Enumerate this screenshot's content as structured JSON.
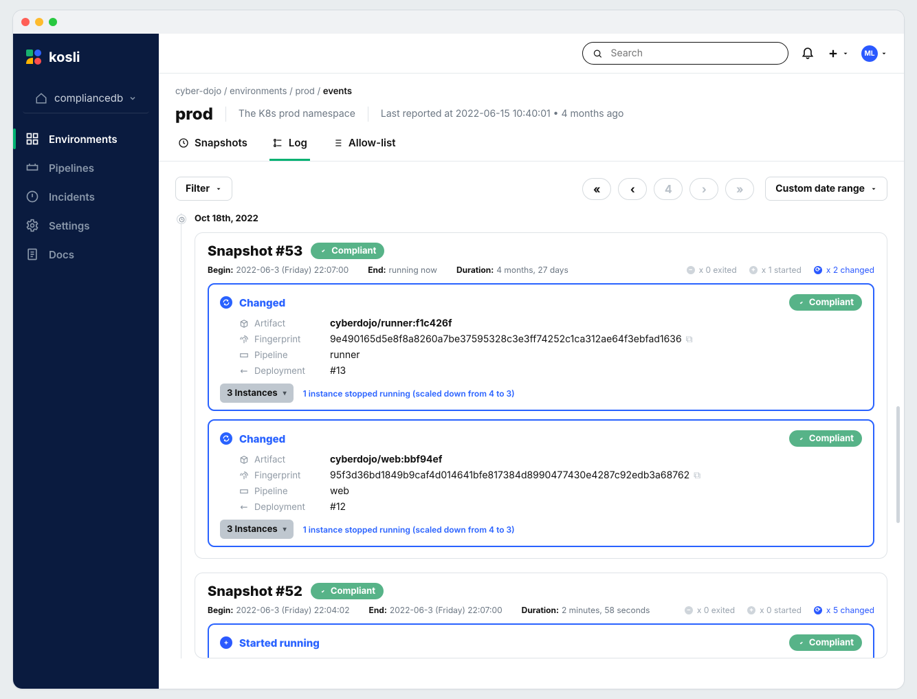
{
  "brand": {
    "name": "kosli"
  },
  "org": {
    "name": "compliancedb"
  },
  "sidebar": {
    "items": [
      {
        "label": "Environments",
        "active": true
      },
      {
        "label": "Pipelines"
      },
      {
        "label": "Incidents"
      },
      {
        "label": "Settings"
      },
      {
        "label": "Docs"
      }
    ]
  },
  "topbar": {
    "search_placeholder": "Search",
    "user_initials": "ML"
  },
  "breadcrumbs": {
    "root": "cyber-dojo",
    "env": "environments",
    "name": "prod",
    "current": "events"
  },
  "env": {
    "title": "prod",
    "desc": "The K8s prod namespace",
    "reported": "Last reported at 2022-06-15 10:40:01 • 4 months ago"
  },
  "tabs": {
    "snapshots": "Snapshots",
    "log": "Log",
    "allowlist": "Allow-list"
  },
  "toolbar": {
    "filter": "Filter",
    "date": "Custom date range",
    "page": "4"
  },
  "timeline": {
    "date": "Oct 18th, 2022"
  },
  "snapshot53": {
    "title": "Snapshot #53",
    "compliant": "Compliant",
    "begin_k": "Begin:",
    "begin_v": "2022-06-3 (Friday) 22:07:00",
    "end_k": "End:",
    "end_v": "running now",
    "dur_k": "Duration:",
    "dur_v": "4 months, 27 days",
    "sum_exited": "x 0 exited",
    "sum_started": "x 1 started",
    "sum_changed": "x 2 changed"
  },
  "event1": {
    "title": "Changed",
    "compliant": "Compliant",
    "artifact_k": "Artifact",
    "artifact_v": "cyberdojo/runner:f1c426f",
    "fp_k": "Fingerprint",
    "fp_v": "9e490165d5e8f8a8260a7be37595328c3e3ff74252c1ca312ae64f3ebfad1636",
    "pipe_k": "Pipeline",
    "pipe_v": "runner",
    "dep_k": "Deployment",
    "dep_v": "#13",
    "chip": "3 Instances",
    "note": "1 instance stopped running (scaled down from 4 to 3)"
  },
  "event2": {
    "title": "Changed",
    "compliant": "Compliant",
    "artifact_k": "Artifact",
    "artifact_v": "cyberdojo/web:bbf94ef",
    "fp_k": "Fingerprint",
    "fp_v": "95f3d36bd1849b9caf4d014641bfe817384d8990477430e4287c92edb3a68762",
    "pipe_k": "Pipeline",
    "pipe_v": "web",
    "dep_k": "Deployment",
    "dep_v": "#12",
    "chip": "3 Instances",
    "note": "1 instance stopped running (scaled down from 4 to 3)"
  },
  "snapshot52": {
    "title": "Snapshot #52",
    "compliant": "Compliant",
    "begin_k": "Begin:",
    "begin_v": "2022-06-3 (Friday) 22:04:02",
    "end_k": "End:",
    "end_v": "2022-06-3 (Friday) 22:07:00",
    "dur_k": "Duration:",
    "dur_v": "2 minutes, 58 seconds",
    "sum_exited": "x 0 exited",
    "sum_started": "x 0 started",
    "sum_changed": "x 5 changed"
  },
  "event3": {
    "title": "Started running",
    "compliant": "Compliant"
  }
}
